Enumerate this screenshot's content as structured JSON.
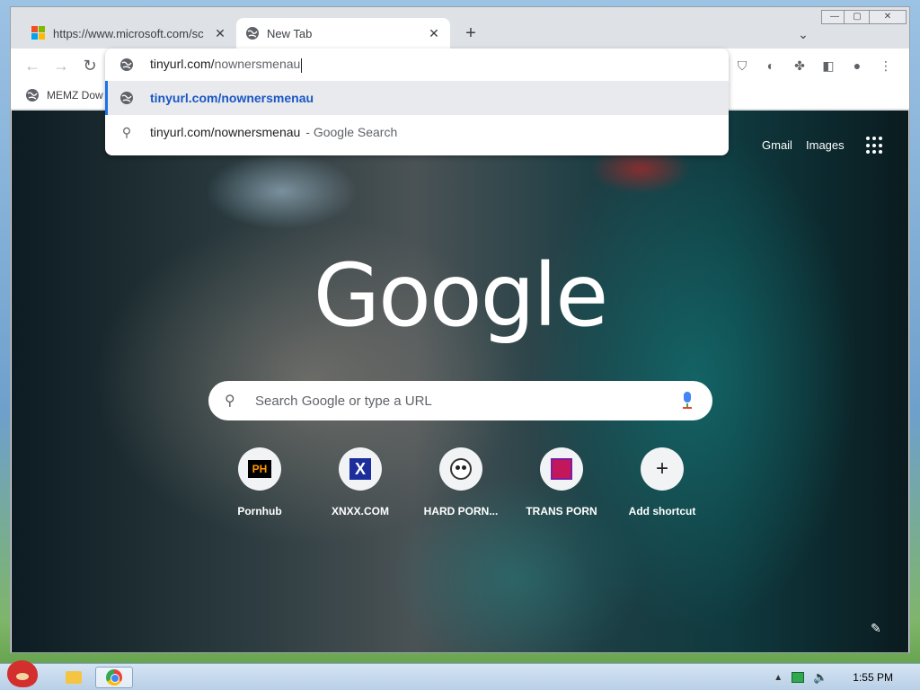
{
  "tabs": [
    {
      "title": "https://www.microsoft.com/sc",
      "favicon": "microsoft-logo",
      "active": false
    },
    {
      "title": "New Tab",
      "favicon": "globe-icon",
      "active": true
    }
  ],
  "omnibox": {
    "typed_base": "tinyurl.com/",
    "typed_rest": "nownersmenau",
    "suggestions": [
      {
        "icon": "globe-icon",
        "text": "tinyurl.com/nownersmenau",
        "selected": true
      },
      {
        "icon": "search-icon",
        "text": "tinyurl.com/nownersmenau",
        "source": "- Google Search",
        "selected": false
      }
    ]
  },
  "bookmarks": [
    {
      "label": "MEMZ Dow",
      "icon": "globe-icon"
    }
  ],
  "ntp": {
    "links": {
      "gmail": "Gmail",
      "images": "Images"
    },
    "logo": "Google",
    "search_placeholder": "Search Google or type a URL",
    "shortcuts": [
      {
        "label": "Pornhub",
        "icon": "PH"
      },
      {
        "label": "XNXX.COM",
        "icon": "X"
      },
      {
        "label": "HARD PORN...",
        "icon": "panda"
      },
      {
        "label": "TRANS PORN",
        "icon": "trans"
      },
      {
        "label": "Add shortcut",
        "icon": "+"
      }
    ]
  },
  "taskbar": {
    "clock": "1:55 PM"
  },
  "colors": {
    "accent": "#1a73e8",
    "suggestion_url": "#1a57c4"
  }
}
